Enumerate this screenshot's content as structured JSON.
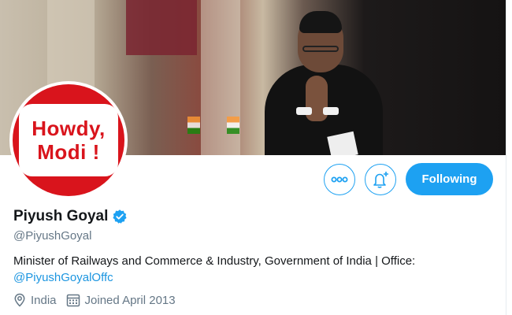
{
  "profile": {
    "avatar_line1": "Howdy,",
    "avatar_line2": "Modi !",
    "name": "Piyush Goyal",
    "handle": "@PiyushGoyal",
    "bio_text": "Minister of Railways and Commerce & Industry, Government of India | Office:",
    "bio_link": "@PiyushGoyalOffc",
    "location": "India",
    "joined": "Joined April 2013"
  },
  "actions": {
    "more_icon": "more-icon",
    "notify_icon": "bell-plus-icon",
    "follow_label": "Following"
  },
  "colors": {
    "accent": "#1da1f2",
    "link": "#1b95e0",
    "secondary_text": "#657786",
    "avatar_red": "#d9141c"
  }
}
